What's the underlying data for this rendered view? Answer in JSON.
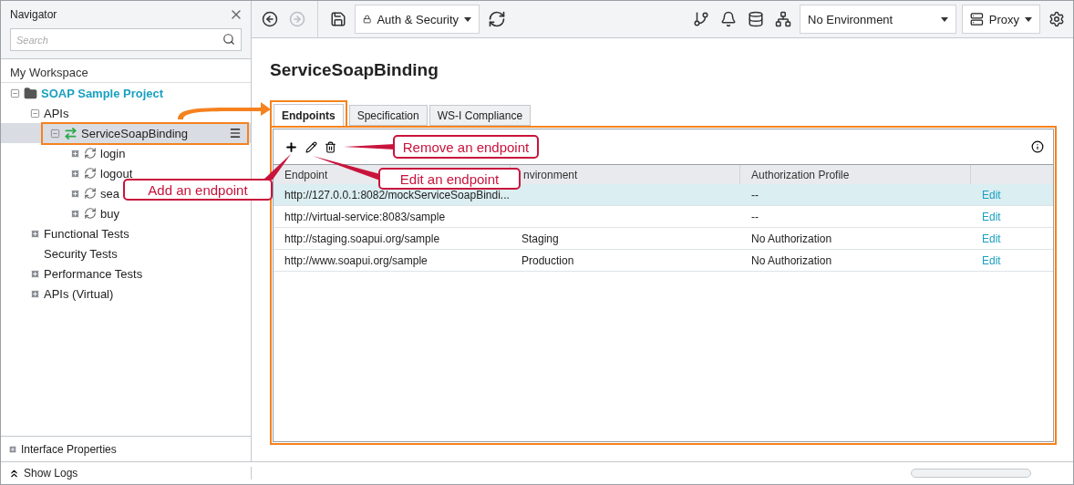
{
  "navigator": {
    "title": "Navigator",
    "search": {
      "placeholder": "Search"
    },
    "workspace": "My Workspace",
    "tree": [
      {
        "label": "SOAP Sample Project",
        "kind": "project",
        "expanded": true,
        "selected": false,
        "children": [
          {
            "label": "APIs",
            "kind": "group",
            "expanded": true,
            "selected": false,
            "children": [
              {
                "label": "ServiceSoapBinding",
                "kind": "api",
                "expanded": true,
                "selected": true,
                "highlighted": true,
                "children": [
                  {
                    "label": "login",
                    "kind": "operation",
                    "expanded": false,
                    "selected": false
                  },
                  {
                    "label": "logout",
                    "kind": "operation",
                    "expanded": false,
                    "selected": false
                  },
                  {
                    "label": "sea",
                    "kind": "operation",
                    "expanded": false,
                    "selected": false
                  },
                  {
                    "label": "buy",
                    "kind": "operation",
                    "expanded": false,
                    "selected": false
                  }
                ]
              }
            ]
          },
          {
            "label": "Functional Tests",
            "kind": "group",
            "expanded": false,
            "selected": false
          },
          {
            "label": "Security Tests",
            "kind": "group",
            "selected": false
          },
          {
            "label": "Performance Tests",
            "kind": "group",
            "expanded": false,
            "selected": false
          },
          {
            "label": "APIs (Virtual)",
            "kind": "group",
            "expanded": false,
            "selected": false
          }
        ]
      }
    ],
    "footer": "Interface Properties"
  },
  "toolbar": {
    "nav": [
      {
        "kind": "back",
        "disabled": false
      },
      {
        "kind": "forward",
        "disabled": true
      }
    ],
    "auth": "Auth & Security",
    "environment": "No Environment",
    "proxy": "Proxy"
  },
  "content": {
    "title": "ServiceSoapBinding",
    "tabs": [
      {
        "label": "Endpoints",
        "selected": true,
        "highlighted": true
      },
      {
        "label": "Specification",
        "selected": false,
        "highlighted": false
      },
      {
        "label": "WS-I Compliance",
        "selected": false,
        "highlighted": false
      }
    ],
    "columns": [
      "Endpoint",
      "nvironment",
      "Authorization Profile"
    ],
    "rows": [
      {
        "endpoint": "http://127.0.0.1:8082/mockServiceSoapBindi...",
        "environment": "",
        "auth": "--",
        "action": "Edit",
        "selected": true
      },
      {
        "endpoint": "http://virtual-service:8083/sample",
        "environment": "",
        "auth": "--",
        "action": "Edit",
        "selected": false
      },
      {
        "endpoint": "http://staging.soapui.org/sample",
        "environment": "Staging",
        "auth": "No Authorization",
        "action": "Edit",
        "selected": false
      },
      {
        "endpoint": "http://www.soapui.org/sample",
        "environment": "Production",
        "auth": "No Authorization",
        "action": "Edit",
        "selected": false
      }
    ]
  },
  "callouts": [
    {
      "kind": "add",
      "text": "Add an endpoint"
    },
    {
      "kind": "remove",
      "text": "Remove an endpoint"
    },
    {
      "kind": "edit",
      "text": "Edit an endpoint"
    }
  ],
  "status_bar": {
    "show_logs": "Show Logs"
  }
}
